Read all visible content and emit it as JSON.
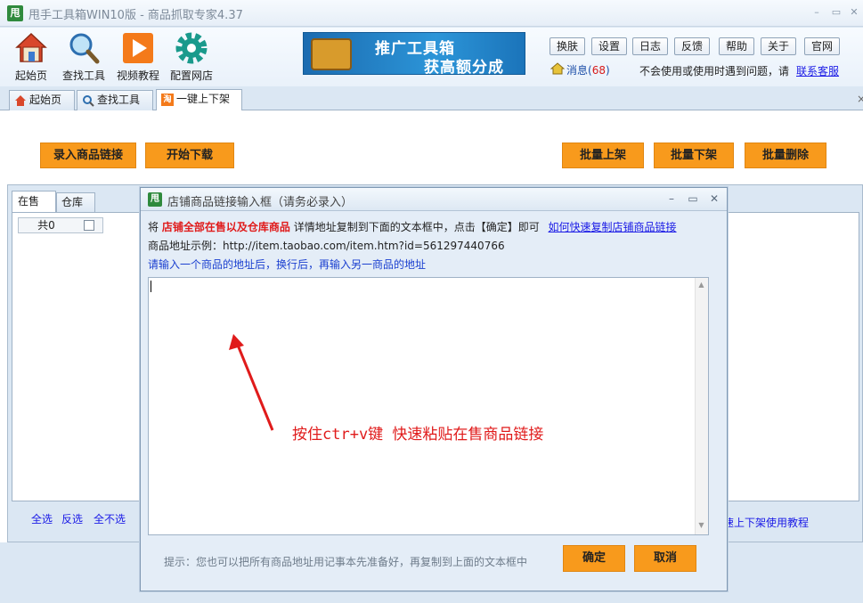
{
  "window": {
    "logo_text": "甩",
    "title": "甩手工具箱WIN10版 - 商品抓取专家4.37",
    "min_glyph": "–",
    "max_glyph": "▭",
    "close_glyph": "✕"
  },
  "toolbar": {
    "items": [
      {
        "label": "起始页",
        "icon": "home-icon"
      },
      {
        "label": "查找工具",
        "icon": "magnifier-icon"
      },
      {
        "label": "视频教程",
        "icon": "play-icon"
      },
      {
        "label": "配置网店",
        "icon": "gear-icon"
      }
    ]
  },
  "banner": {
    "line1": "推广工具箱",
    "line2": "获高额分成"
  },
  "top_buttons": [
    "换肤",
    "设置",
    "日志",
    "反馈",
    "帮助",
    "关于",
    "官网"
  ],
  "messages": {
    "label": "消息(",
    "count": "68",
    "close": ")"
  },
  "help": {
    "text": "不会使用或使用时遇到问题，请",
    "link": "联系客服"
  },
  "tabs": [
    {
      "label": "起始页",
      "icon": "home-icon"
    },
    {
      "label": "查找工具",
      "icon": "magnifier-icon"
    },
    {
      "label": "一键上下架",
      "icon": "taobao-icon",
      "active": true
    }
  ],
  "tab_close": "×",
  "actions": {
    "import_links": "录入商品链接",
    "start_download": "开始下载",
    "batch_list": "批量上架",
    "batch_delist": "批量下架",
    "batch_delete": "批量删除"
  },
  "subtabs": {
    "onsale": "在售",
    "warehouse": "仓库"
  },
  "grid": {
    "total": "共0"
  },
  "selection": {
    "all": "全选",
    "invert": "反选",
    "none": "全不选"
  },
  "tutorial_link": "速上下架使用教程",
  "dialog": {
    "logo_text": "甩",
    "title": "店铺商品链接输入框（请务必录入）",
    "line1_prefix": "将",
    "line1_red": "店铺全部在售以及仓库商品",
    "line1_mid": "详情地址复制到下面的文本框中，点击【确定】即可",
    "line1_link": "如何快速复制店铺商品链接",
    "line2": "商品地址示例：http://item.taobao.com/item.htm?id=561297440766",
    "line3": "请输入一个商品的地址后，换行后，再输入另一商品的地址",
    "annotation": "按住ctr+v键 快速粘贴在售商品链接",
    "tip": "提示：您也可以把所有商品地址用记事本先准备好，再复制到上面的文本框中",
    "ok": "确定",
    "cancel": "取消",
    "textarea_value": "",
    "min_glyph": "–",
    "max_glyph": "▭",
    "close_glyph": "✕"
  },
  "colors": {
    "accent_orange": "#f89a1c",
    "link_blue": "#1a1ae6",
    "alert_red": "#e01b1b",
    "app_green": "#2f8a3d"
  }
}
